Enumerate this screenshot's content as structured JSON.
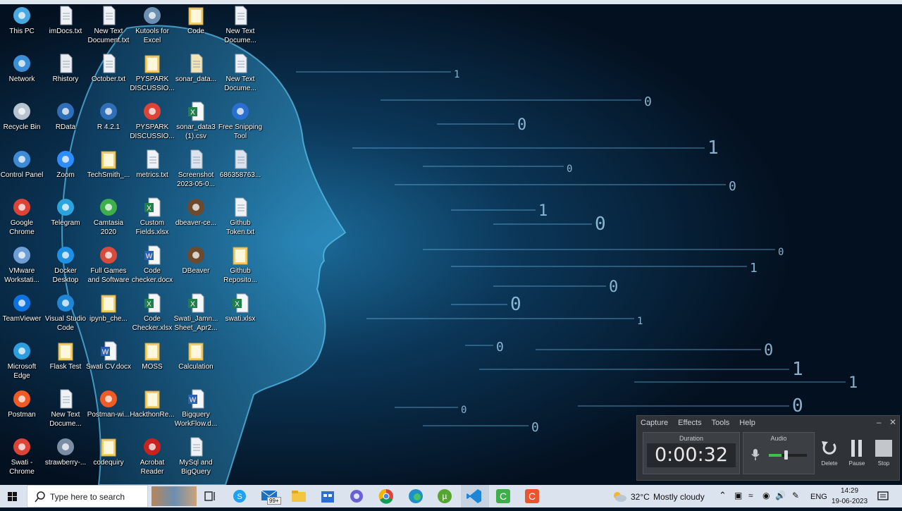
{
  "desktop": {
    "icons": [
      {
        "label": "This PC",
        "icon": "this-pc-icon"
      },
      {
        "label": "Network",
        "icon": "network-icon"
      },
      {
        "label": "Recycle Bin",
        "icon": "recycle-bin-icon"
      },
      {
        "label": "Control Panel",
        "icon": "control-panel-icon"
      },
      {
        "label": "Google Chrome",
        "icon": "chrome-icon"
      },
      {
        "label": "VMware Workstati...",
        "icon": "vmware-icon"
      },
      {
        "label": "TeamViewer",
        "icon": "teamviewer-icon"
      },
      {
        "label": "Microsoft Edge",
        "icon": "edge-icon"
      },
      {
        "label": "Postman",
        "icon": "postman-icon"
      },
      {
        "label": "Swati - Chrome",
        "icon": "chrome-icon"
      },
      {
        "label": "imDocs.txt",
        "icon": "text-file-icon"
      },
      {
        "label": "Rhistory",
        "icon": "rhistory-file-icon"
      },
      {
        "label": "RData",
        "icon": "r-icon"
      },
      {
        "label": "Zoom",
        "icon": "zoom-icon"
      },
      {
        "label": "Telegram",
        "icon": "telegram-icon"
      },
      {
        "label": "Docker Desktop",
        "icon": "docker-icon"
      },
      {
        "label": "Visual Studio Code",
        "icon": "vscode-icon"
      },
      {
        "label": "Flask Test",
        "icon": "folder-icon"
      },
      {
        "label": "New Text Docume...",
        "icon": "text-file-icon"
      },
      {
        "label": "strawberry-...",
        "icon": "installer-icon"
      },
      {
        "label": "New Text Document.txt",
        "icon": "text-file-icon"
      },
      {
        "label": "October.txt",
        "icon": "text-file-icon"
      },
      {
        "label": "R 4.2.1",
        "icon": "r-icon"
      },
      {
        "label": "TechSmith_...",
        "icon": "folder-icon"
      },
      {
        "label": "Camtasia 2020",
        "icon": "camtasia-icon"
      },
      {
        "label": "Full Games and Software",
        "icon": "games-icon"
      },
      {
        "label": "ipynb_che...",
        "icon": "folder-icon"
      },
      {
        "label": "Swati CV.docx",
        "icon": "word-icon"
      },
      {
        "label": "Postman-wi...",
        "icon": "postman-icon"
      },
      {
        "label": "codequiry",
        "icon": "folder-icon"
      },
      {
        "label": "Kutools for Excel",
        "icon": "kutools-icon"
      },
      {
        "label": "PYSPARK DISCUSSIO...",
        "icon": "folder-icon"
      },
      {
        "label": "PYSPARK DISCUSSIO...",
        "icon": "chrome-icon"
      },
      {
        "label": "metrics.txt",
        "icon": "text-file-icon"
      },
      {
        "label": "Custom Fields.xlsx",
        "icon": "excel-icon"
      },
      {
        "label": "Code checker.docx",
        "icon": "word-icon"
      },
      {
        "label": "Code Checker.xlsx",
        "icon": "excel-icon"
      },
      {
        "label": "MOSS",
        "icon": "folder-icon"
      },
      {
        "label": "HackthonRe...",
        "icon": "folder-icon"
      },
      {
        "label": "Acrobat Reader",
        "icon": "acrobat-icon"
      },
      {
        "label": "Code",
        "icon": "folder-icon"
      },
      {
        "label": "sonar_data...",
        "icon": "json-file-icon"
      },
      {
        "label": "sonar_data3 (1).csv",
        "icon": "excel-icon"
      },
      {
        "label": "Screenshot 2023-05-0...",
        "icon": "image-file-icon"
      },
      {
        "label": "dbeaver-ce...",
        "icon": "dbeaver-icon"
      },
      {
        "label": "DBeaver",
        "icon": "dbeaver-icon"
      },
      {
        "label": "Swati_Jamn... Sheet_Apr2...",
        "icon": "excel-icon"
      },
      {
        "label": "Calculation",
        "icon": "folder-icon"
      },
      {
        "label": "Bigquery WorkFlow.d...",
        "icon": "word-icon"
      },
      {
        "label": "MySql and BigQuery",
        "icon": "text-file-icon"
      },
      {
        "label": "New Text Docume...",
        "icon": "text-file-icon"
      },
      {
        "label": "New Text Docume...",
        "icon": "text-file-icon"
      },
      {
        "label": "Free Snipping Tool",
        "icon": "snipping-icon"
      },
      {
        "label": "686358763...",
        "icon": "image-file-icon"
      },
      {
        "label": "Github Token.txt",
        "icon": "text-file-icon"
      },
      {
        "label": "Github Reposito...",
        "icon": "folder-icon"
      },
      {
        "label": "swati.xlsx",
        "icon": "excel-icon"
      }
    ]
  },
  "recorder": {
    "menu": [
      "Capture",
      "Effects",
      "Tools",
      "Help"
    ],
    "duration_label": "Duration",
    "duration_value": "0:00:32",
    "audio_label": "Audio",
    "delete_label": "Delete",
    "pause_label": "Pause",
    "stop_label": "Stop"
  },
  "taskbar": {
    "search_placeholder": "Type here to search",
    "mail_badge": "99+",
    "apps": [
      "task-view-icon",
      "skype-icon",
      "mail-icon",
      "file-explorer-icon",
      "store-icon",
      "copilot-icon",
      "chrome-icon",
      "edge-icon",
      "utorrent-icon",
      "vscode-icon",
      "camtasia-icon",
      "camtasia-recorder-icon"
    ],
    "weather_temp": "32°C",
    "weather_desc": "Mostly cloudy",
    "language": "ENG",
    "time": "14:29",
    "date": "19-06-2023"
  },
  "colors": {
    "accent": "#4aa8e0",
    "taskbar": "#dbe4ee",
    "recorder_bg": "#2f3236"
  }
}
